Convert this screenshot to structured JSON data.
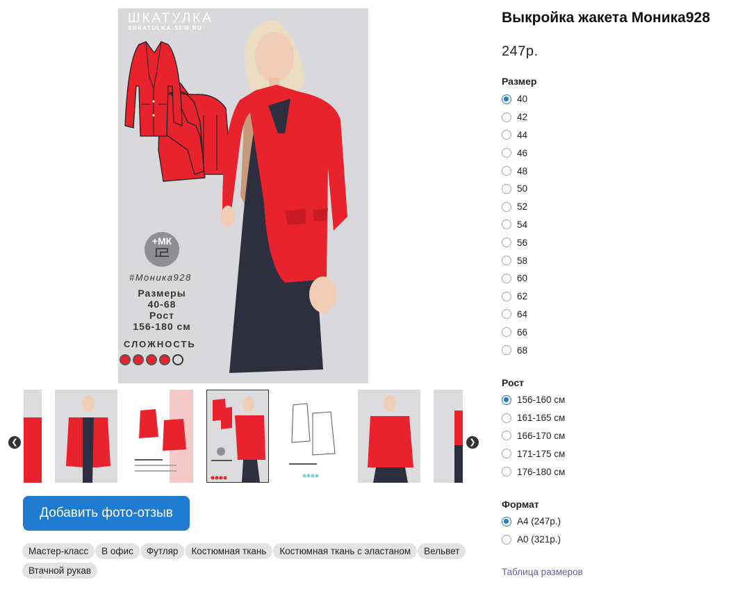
{
  "product": {
    "title": "Выкройка жакета Моника928",
    "price": "247р."
  },
  "cover": {
    "brand": "ШКАТУЛКА",
    "brand_url": "SHKATULKA-SEW.RU",
    "mk_badge": "+МК",
    "hashtag": "#Моника928",
    "sizes_label": "Размеры",
    "sizes_value": "40-68",
    "height_label": "Рост",
    "height_value": "156-180 см",
    "difficulty_label": "СЛОЖНОСТЬ",
    "difficulty_level": 4,
    "difficulty_max": 5,
    "jacket_color": "#e8232d"
  },
  "gallery": {
    "prev_icon": "chevron-left-icon",
    "next_icon": "chevron-right-icon",
    "active_index": 3
  },
  "review_button": "Добавить фото-отзыв",
  "tags": [
    "Мастер-класс",
    "В офис",
    "Футляр",
    "Костюмная ткань",
    "Костюмная ткань с эластаном",
    "Вельвет",
    "Втачной рукав"
  ],
  "options": {
    "size": {
      "label": "Размер",
      "selected": "40",
      "values": [
        "40",
        "42",
        "44",
        "46",
        "48",
        "50",
        "52",
        "54",
        "56",
        "58",
        "60",
        "62",
        "64",
        "66",
        "68"
      ]
    },
    "height": {
      "label": "Рост",
      "selected": "156-160 см",
      "values": [
        "156-160 см",
        "161-165 см",
        "166-170 см",
        "171-175 см",
        "176-180 см"
      ]
    },
    "format": {
      "label": "Формат",
      "selected": "A4 (247р.)",
      "values": [
        "A4 (247р.)",
        "A0 (321р.)"
      ]
    }
  },
  "size_chart_link": "Таблица размеров",
  "accent_color": "#1e7bd0"
}
